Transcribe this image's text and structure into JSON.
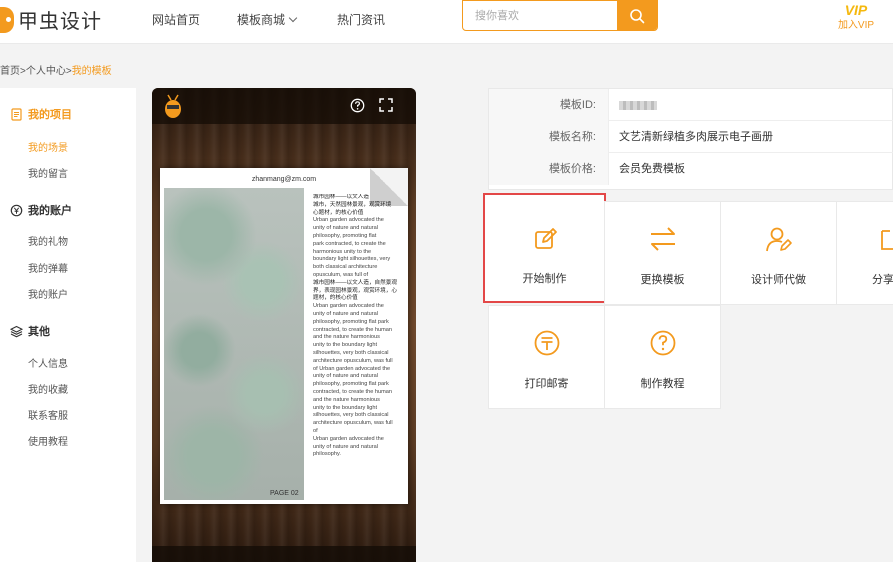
{
  "brand": {
    "logo_text": "甲虫设计"
  },
  "nav": {
    "home": "网站首页",
    "market": "模板商城",
    "news": "热门资讯"
  },
  "search": {
    "placeholder": "搜你喜欢"
  },
  "vip": {
    "badge": "VIP",
    "label": "加入VIP"
  },
  "breadcrumb": {
    "part1": "首页",
    "sep": ">",
    "part2": "个人中心",
    "current": "我的模板"
  },
  "sidebar": {
    "projects": {
      "title": "我的项目",
      "items": [
        "我的场景",
        "我的留言"
      ]
    },
    "account": {
      "title": "我的账户",
      "items": [
        "我的礼物",
        "我的弹幕",
        "我的账户"
      ]
    },
    "other": {
      "title": "其他",
      "items": [
        "个人信息",
        "我的收藏",
        "联系客服",
        "使用教程"
      ]
    }
  },
  "preview": {
    "email": "zhanmang@zm.com",
    "page_label": "PAGE 02",
    "text_block_1": "城市园林——以文人造\n城市，天然园林景观，观赏环境\n心题材，的核心价值",
    "text_block_2": "Urban garden advocated the\nunity of nature and natural\nphilosophy, promoting flat\npark contracted, to create the\nharmonious unity to the\nboundary light silhouettes, very\nboth classical architecture\nopusculum, was full of",
    "text_block_3": "城市园林——以文人造，自然景观\n界，表现园林景观，观赏环境，心\n题材，的核心价值",
    "text_block_4": "Urban garden advocated the\nunity of nature and natural\nphilosophy, promoting flat park\ncontracted, to create the human\nand the nature harmonious\nunity to the boundary light\nsilhouettes, very both classical\narchitecture opusculum, was full\nof Urban garden advocated the\nunity of nature and natural\nphilosophy, promoting flat park\ncontracted, to create the human\nand the nature harmonious\nunity to the boundary light\nsilhouettes, very both classical\narchitecture opusculum, was full\nof\nUrban garden advocated the\nunity of nature and natural\nphilosophy."
  },
  "info": {
    "id_label": "模板ID:",
    "name_label": "模板名称:",
    "name_value": "文艺清新绿植多肉展示电子画册",
    "price_label": "模板价格:",
    "price_value": "会员免费模板"
  },
  "actions": {
    "start": "开始制作",
    "change": "更换模板",
    "designer": "设计师代做",
    "share": "分享",
    "print": "打印邮寄",
    "tutorial": "制作教程"
  },
  "colors": {
    "accent": "#f39a1e",
    "highlight": "#e34747"
  }
}
